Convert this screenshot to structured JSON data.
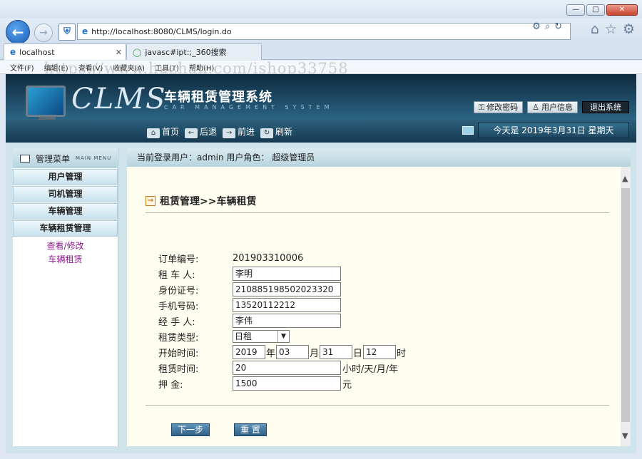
{
  "browser": {
    "url": "http://localhost:8080/CLMS/login.do",
    "tabs": [
      {
        "label": "localhost"
      },
      {
        "label": "javasc#ipt:;_360搜索"
      }
    ],
    "menu": [
      "文件(F)",
      "编辑(E)",
      "查看(V)",
      "收藏夹(A)",
      "工具(T)",
      "帮助(H)"
    ],
    "watermark": "https://www.huzhan.com/ishop33758"
  },
  "banner": {
    "logo": "CLMS",
    "system_name": "车辆租赁管理系统",
    "system_en": "CAR MANAGEMENT SYSTEM",
    "links": {
      "change_password": "修改密码",
      "user_info": "用户信息",
      "logout": "退出系统"
    }
  },
  "nav": {
    "home": "首页",
    "back": "后退",
    "forward": "前进",
    "refresh": "刷新",
    "date": "今天是  2019年3月31日  星期天"
  },
  "sidebar": {
    "title": "管理菜单",
    "title_en": "MAIN MENU",
    "items": [
      "用户管理",
      "司机管理",
      "车辆管理",
      "车辆租赁管理"
    ],
    "sublinks": [
      "查看/修改",
      "车辆租赁"
    ]
  },
  "userbar": "当前登录用户：admin  用户角色：  超级管理员",
  "page": {
    "heading": "租赁管理>>车辆租赁",
    "fields": {
      "order_no_label": "订单编号:",
      "order_no": "201903310006",
      "renter_label": "租  车  人:",
      "renter": "李明",
      "id_label": "身份证号:",
      "id_no": "210885198502023320",
      "phone_label": "手机号码:",
      "phone": "13520112212",
      "handler_label": "经  手  人:",
      "handler": "李伟",
      "type_label": "租赁类型:",
      "type": "日租",
      "start_label": "开始时间:",
      "year": "2019",
      "year_unit": "年",
      "month": "03",
      "month_unit": "月",
      "day": "31",
      "day_unit": "日",
      "hour": "12",
      "hour_unit": "时",
      "duration_label": "租赁时间:",
      "duration": "20",
      "duration_unit": "小时/天/月/年",
      "deposit_label": "押      金:",
      "deposit": "1500",
      "deposit_unit": "元"
    },
    "buttons": {
      "next": "下一步",
      "reset": "重  置"
    }
  }
}
